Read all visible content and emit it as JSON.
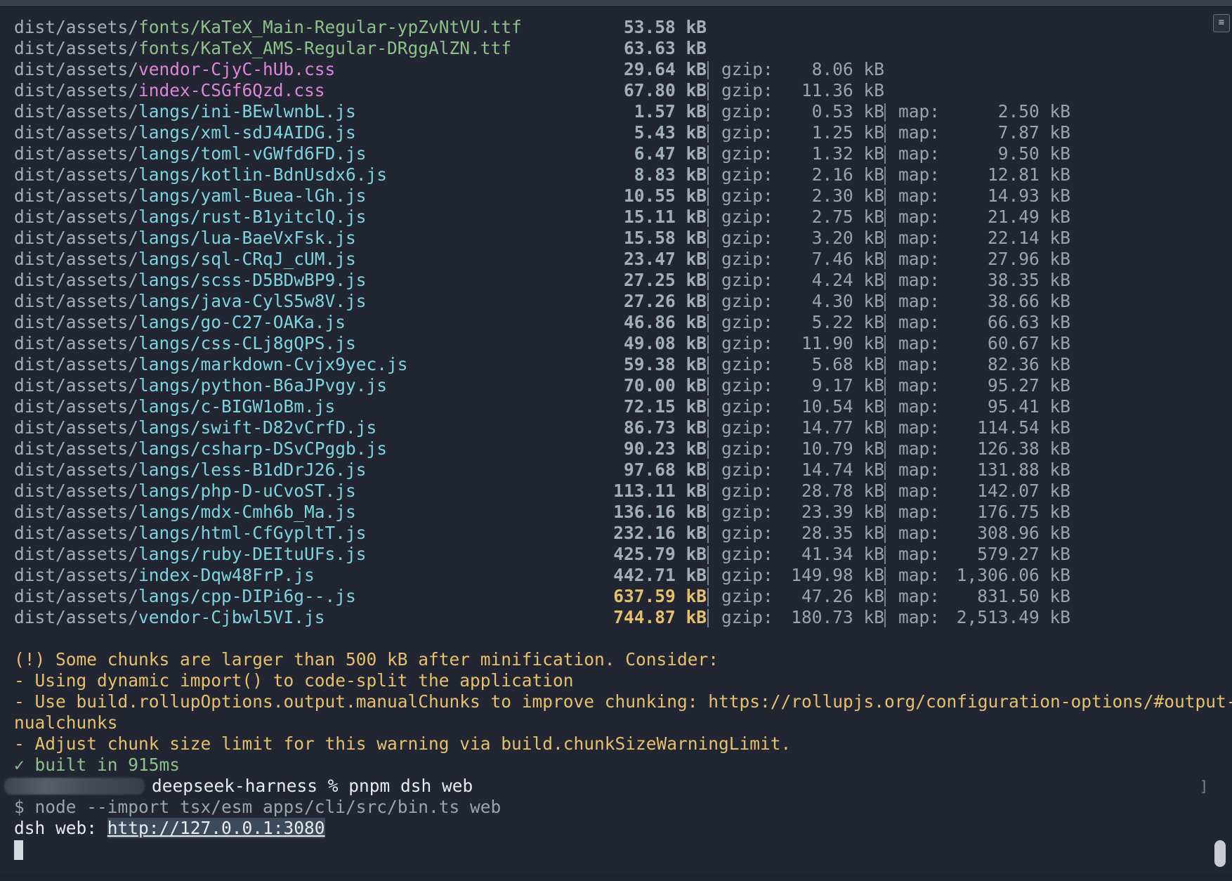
{
  "terminal": {
    "files": [
      {
        "dir": "dist/assets/",
        "name": "fonts/KaTeX_Main-Regular-ypZvNtVU.ttf",
        "kind": "green",
        "size": "53.58 kB",
        "gzip": "",
        "map": "",
        "large": false
      },
      {
        "dir": "dist/assets/",
        "name": "fonts/KaTeX_AMS-Regular-DRggAlZN.ttf",
        "kind": "green",
        "size": "63.63 kB",
        "gzip": "",
        "map": "",
        "large": false
      },
      {
        "dir": "dist/assets/",
        "name": "vendor-CjyC-hUb.css",
        "kind": "magenta",
        "size": "29.64 kB",
        "gzip": "8.06 kB",
        "map": "",
        "large": false
      },
      {
        "dir": "dist/assets/",
        "name": "index-CSGf6Qzd.css",
        "kind": "magenta",
        "size": "67.80 kB",
        "gzip": "11.36 kB",
        "map": "",
        "large": false
      },
      {
        "dir": "dist/assets/",
        "name": "langs/ini-BEwlwnbL.js",
        "kind": "cyan",
        "size": "1.57 kB",
        "gzip": "0.53 kB",
        "map": "2.50 kB",
        "large": false
      },
      {
        "dir": "dist/assets/",
        "name": "langs/xml-sdJ4AIDG.js",
        "kind": "cyan",
        "size": "5.43 kB",
        "gzip": "1.25 kB",
        "map": "7.87 kB",
        "large": false
      },
      {
        "dir": "dist/assets/",
        "name": "langs/toml-vGWfd6FD.js",
        "kind": "cyan",
        "size": "6.47 kB",
        "gzip": "1.32 kB",
        "map": "9.50 kB",
        "large": false
      },
      {
        "dir": "dist/assets/",
        "name": "langs/kotlin-BdnUsdx6.js",
        "kind": "cyan",
        "size": "8.83 kB",
        "gzip": "2.16 kB",
        "map": "12.81 kB",
        "large": false
      },
      {
        "dir": "dist/assets/",
        "name": "langs/yaml-Buea-lGh.js",
        "kind": "cyan",
        "size": "10.55 kB",
        "gzip": "2.30 kB",
        "map": "14.93 kB",
        "large": false
      },
      {
        "dir": "dist/assets/",
        "name": "langs/rust-B1yitclQ.js",
        "kind": "cyan",
        "size": "15.11 kB",
        "gzip": "2.75 kB",
        "map": "21.49 kB",
        "large": false
      },
      {
        "dir": "dist/assets/",
        "name": "langs/lua-BaeVxFsk.js",
        "kind": "cyan",
        "size": "15.58 kB",
        "gzip": "3.20 kB",
        "map": "22.14 kB",
        "large": false
      },
      {
        "dir": "dist/assets/",
        "name": "langs/sql-CRqJ_cUM.js",
        "kind": "cyan",
        "size": "23.47 kB",
        "gzip": "7.46 kB",
        "map": "27.96 kB",
        "large": false
      },
      {
        "dir": "dist/assets/",
        "name": "langs/scss-D5BDwBP9.js",
        "kind": "cyan",
        "size": "27.25 kB",
        "gzip": "4.24 kB",
        "map": "38.35 kB",
        "large": false
      },
      {
        "dir": "dist/assets/",
        "name": "langs/java-CylS5w8V.js",
        "kind": "cyan",
        "size": "27.26 kB",
        "gzip": "4.30 kB",
        "map": "38.66 kB",
        "large": false
      },
      {
        "dir": "dist/assets/",
        "name": "langs/go-C27-OAKa.js",
        "kind": "cyan",
        "size": "46.86 kB",
        "gzip": "5.22 kB",
        "map": "66.63 kB",
        "large": false
      },
      {
        "dir": "dist/assets/",
        "name": "langs/css-CLj8gQPS.js",
        "kind": "cyan",
        "size": "49.08 kB",
        "gzip": "11.90 kB",
        "map": "60.67 kB",
        "large": false
      },
      {
        "dir": "dist/assets/",
        "name": "langs/markdown-Cvjx9yec.js",
        "kind": "cyan",
        "size": "59.38 kB",
        "gzip": "5.68 kB",
        "map": "82.36 kB",
        "large": false
      },
      {
        "dir": "dist/assets/",
        "name": "langs/python-B6aJPvgy.js",
        "kind": "cyan",
        "size": "70.00 kB",
        "gzip": "9.17 kB",
        "map": "95.27 kB",
        "large": false
      },
      {
        "dir": "dist/assets/",
        "name": "langs/c-BIGW1oBm.js",
        "kind": "cyan",
        "size": "72.15 kB",
        "gzip": "10.54 kB",
        "map": "95.41 kB",
        "large": false
      },
      {
        "dir": "dist/assets/",
        "name": "langs/swift-D82vCrfD.js",
        "kind": "cyan",
        "size": "86.73 kB",
        "gzip": "14.77 kB",
        "map": "114.54 kB",
        "large": false
      },
      {
        "dir": "dist/assets/",
        "name": "langs/csharp-DSvCPggb.js",
        "kind": "cyan",
        "size": "90.23 kB",
        "gzip": "10.79 kB",
        "map": "126.38 kB",
        "large": false
      },
      {
        "dir": "dist/assets/",
        "name": "langs/less-B1dDrJ26.js",
        "kind": "cyan",
        "size": "97.68 kB",
        "gzip": "14.74 kB",
        "map": "131.88 kB",
        "large": false
      },
      {
        "dir": "dist/assets/",
        "name": "langs/php-D-uCvoST.js",
        "kind": "cyan",
        "size": "113.11 kB",
        "gzip": "28.78 kB",
        "map": "142.07 kB",
        "large": false
      },
      {
        "dir": "dist/assets/",
        "name": "langs/mdx-Cmh6b_Ma.js",
        "kind": "cyan",
        "size": "136.16 kB",
        "gzip": "23.39 kB",
        "map": "176.75 kB",
        "large": false
      },
      {
        "dir": "dist/assets/",
        "name": "langs/html-CfGypltT.js",
        "kind": "cyan",
        "size": "232.16 kB",
        "gzip": "28.35 kB",
        "map": "308.96 kB",
        "large": false
      },
      {
        "dir": "dist/assets/",
        "name": "langs/ruby-DEItuUFs.js",
        "kind": "cyan",
        "size": "425.79 kB",
        "gzip": "41.34 kB",
        "map": "579.27 kB",
        "large": false
      },
      {
        "dir": "dist/assets/",
        "name": "index-Dqw48FrP.js",
        "kind": "cyan",
        "size": "442.71 kB",
        "gzip": "149.98 kB",
        "map": "1,306.06 kB",
        "large": false
      },
      {
        "dir": "dist/assets/",
        "name": "langs/cpp-DIPi6g--.js",
        "kind": "cyan",
        "size": "637.59 kB",
        "gzip": "47.26 kB",
        "map": "831.50 kB",
        "large": true
      },
      {
        "dir": "dist/assets/",
        "name": "vendor-Cjbwl5VI.js",
        "kind": "cyan",
        "size": "744.87 kB",
        "gzip": "180.73 kB",
        "map": "2,513.49 kB",
        "large": true
      }
    ],
    "gzip_label": "gzip:",
    "map_label": "map:",
    "warning_lines": [
      "(!) Some chunks are larger than 500 kB after minification. Consider:",
      "- Using dynamic import() to code-split the application",
      "- Use build.rollupOptions.output.manualChunks to improve chunking: https://rollupjs.org/configuration-options/#output-ma",
      "nualchunks",
      "- Adjust chunk size limit for this warning via build.chunkSizeWarningLimit."
    ],
    "built_check": "✓",
    "built_text": "built in 915ms",
    "prompt_text": "deepseek-harness % pnpm dsh web",
    "prompt_bracket": "]",
    "cmd_echo": "$ node --import tsx/esm apps/cli/src/bin.ts web",
    "server_label": "dsh web: ",
    "server_url": "http://127.0.0.1:3080",
    "scroll_icon": "≡",
    "colors": {
      "background": "#222633",
      "green": "#8cc287",
      "magenta": "#dc86d8",
      "cyan": "#7ed4dc",
      "warning": "#e6c06a"
    }
  }
}
